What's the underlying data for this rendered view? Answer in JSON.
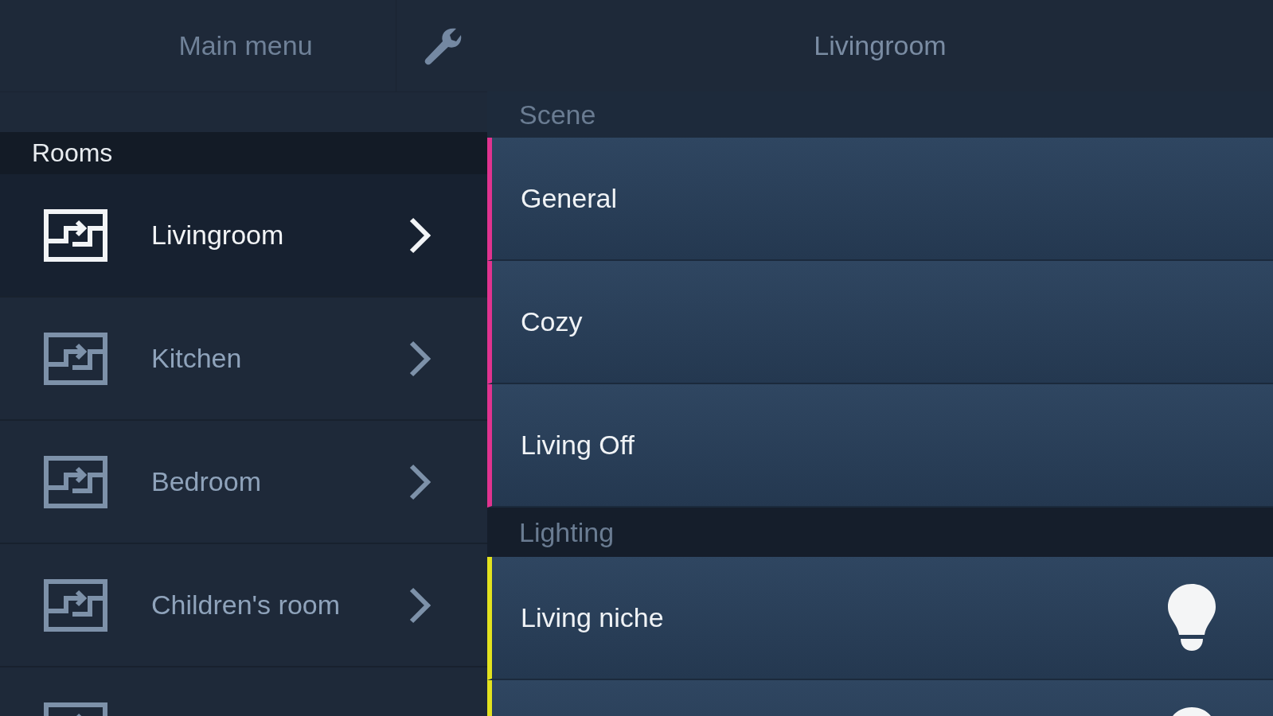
{
  "sidebar": {
    "title": "Main menu",
    "group_title": "Rooms",
    "items": [
      {
        "label": "Livingroom",
        "selected": true
      },
      {
        "label": "Kitchen",
        "selected": false
      },
      {
        "label": "Bedroom",
        "selected": false
      },
      {
        "label": "Children's room",
        "selected": false
      },
      {
        "selected": false
      }
    ]
  },
  "main": {
    "title": "Livingroom",
    "sections": [
      {
        "title": "Scene",
        "kind": "scene",
        "color": "#e0338f",
        "items": [
          {
            "label": "General"
          },
          {
            "label": "Cozy"
          },
          {
            "label": "Living Off"
          }
        ]
      },
      {
        "title": "Lighting",
        "kind": "light",
        "color": "#e2e21e",
        "items": [
          {
            "label": "Living niche",
            "on": true
          },
          {
            "on": true
          }
        ]
      }
    ]
  }
}
